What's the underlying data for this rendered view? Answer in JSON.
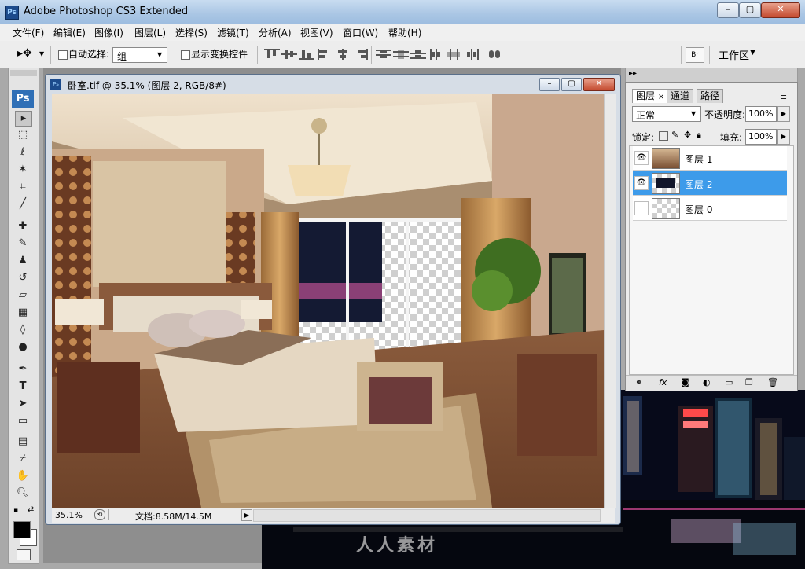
{
  "app": {
    "title": "Adobe Photoshop CS3 Extended",
    "icon_text": "Ps",
    "window_controls": [
      "minimize-icon",
      "maximize-icon",
      "close-icon"
    ]
  },
  "menu": [
    "文件(F)",
    "编辑(E)",
    "图像(I)",
    "图层(L)",
    "选择(S)",
    "滤镜(T)",
    "分析(A)",
    "视图(V)",
    "窗口(W)",
    "帮助(H)"
  ],
  "options": {
    "auto_select_label": "自动选择:",
    "auto_select_value": "组",
    "show_transform_label": "显示变换控件",
    "workspace_label": "工作区"
  },
  "toolbar": {
    "ps_logo": "Ps"
  },
  "document": {
    "title": "卧室.tif @ 35.1% (图层 2, RGB/8#)",
    "zoom": "35.1%",
    "doc_info": "文档:8.58M/14.5M"
  },
  "layers_panel": {
    "tabs": [
      "图层",
      "通道",
      "路径"
    ],
    "blend_mode": "正常",
    "opacity_label": "不透明度:",
    "opacity_value": "100%",
    "lock_label": "锁定:",
    "fill_label": "填充:",
    "fill_value": "100%",
    "layers": [
      {
        "name": "图层 1",
        "visible": true,
        "selected": false
      },
      {
        "name": "图层 2",
        "visible": true,
        "selected": true
      },
      {
        "name": "图层 0",
        "visible": false,
        "selected": false
      }
    ]
  },
  "watermark": "人人素材",
  "colors": {
    "selection_blue": "#3d9bea",
    "titlebar": "#aac6e4",
    "close_red": "#c44a2e"
  }
}
